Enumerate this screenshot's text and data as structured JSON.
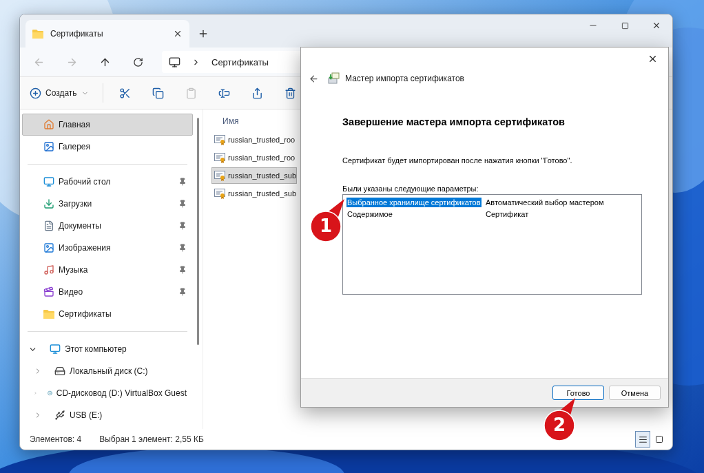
{
  "explorer": {
    "tabs": [
      {
        "label": "Сертификаты",
        "selected": true
      }
    ],
    "address": {
      "path": [
        "Сертификаты"
      ]
    },
    "toolbar": {
      "new_label": "Создать",
      "actions": [
        {
          "kind": "cut",
          "disabled": false
        },
        {
          "kind": "copy",
          "disabled": false
        },
        {
          "kind": "paste",
          "disabled": true
        },
        {
          "kind": "rename",
          "disabled": false
        },
        {
          "kind": "share",
          "disabled": false
        },
        {
          "kind": "delete",
          "disabled": false
        }
      ]
    },
    "nav": {
      "sections": [
        {
          "items": [
            {
              "label": "Главная",
              "kind": "home",
              "pinned": false,
              "selected": true
            },
            {
              "label": "Галерея",
              "kind": "gallery",
              "pinned": false,
              "selected": false
            }
          ]
        },
        {
          "items": [
            {
              "label": "Рабочий стол",
              "kind": "desktop",
              "pinned": true,
              "selected": false
            },
            {
              "label": "Загрузки",
              "kind": "downloads",
              "pinned": true,
              "selected": false
            },
            {
              "label": "Документы",
              "kind": "documents",
              "pinned": true,
              "selected": false
            },
            {
              "label": "Изображения",
              "kind": "pictures",
              "pinned": true,
              "selected": false
            },
            {
              "label": "Музыка",
              "kind": "music",
              "pinned": true,
              "selected": false
            },
            {
              "label": "Видео",
              "kind": "video",
              "pinned": true,
              "selected": false
            },
            {
              "label": "Сертификаты",
              "kind": "folder",
              "pinned": false,
              "selected": false
            }
          ]
        }
      ],
      "this_pc": {
        "label": "Этот компьютер",
        "expanded": true,
        "children": [
          {
            "label": "Локальный диск (C:)",
            "kind": "disk"
          },
          {
            "label": "CD-дисковод (D:) VirtualBox Guest",
            "kind": "cd"
          },
          {
            "label": "USB (E:)",
            "kind": "usb"
          }
        ]
      }
    },
    "files": {
      "column": "Имя",
      "rows": [
        {
          "name": "russian_trusted_roo",
          "selected": false
        },
        {
          "name": "russian_trusted_roo",
          "selected": false
        },
        {
          "name": "russian_trusted_sub",
          "selected": true
        },
        {
          "name": "russian_trusted_sub",
          "selected": false
        }
      ]
    },
    "status": {
      "count": "Элементов: 4",
      "selection": "Выбран 1 элемент: 2,55 КБ"
    },
    "view_modes": [
      {
        "kind": "details",
        "selected": true
      },
      {
        "kind": "tiles",
        "selected": false
      }
    ]
  },
  "dialog": {
    "title": "Мастер импорта сертификатов",
    "heading": "Завершение мастера импорта сертификатов",
    "message": "Сертификат будет импортирован после нажатия кнопки \"Готово\".",
    "list_label": "Были указаны следующие параметры:",
    "settings": [
      {
        "name": "Выбранное хранилище сертификатов",
        "value": "Автоматический выбор мастером",
        "selected": true
      },
      {
        "name": "Содержимое",
        "value": "Сертификат",
        "selected": false
      }
    ],
    "buttons": [
      {
        "label": "Готово",
        "default": true
      },
      {
        "label": "Отмена",
        "default": false
      }
    ]
  },
  "callouts": [
    "1",
    "2"
  ]
}
